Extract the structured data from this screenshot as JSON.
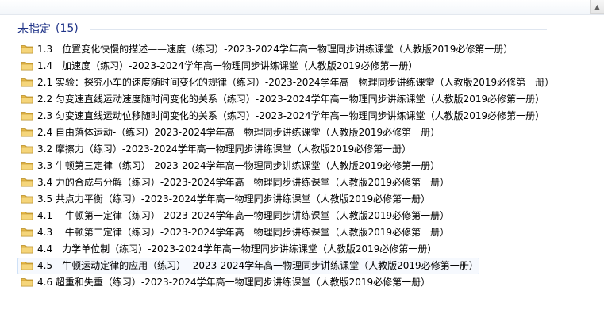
{
  "group": {
    "title": "未指定",
    "count": "(15)"
  },
  "folder_color": "#e8bb4a",
  "items": [
    {
      "label": "1.3　位置变化快慢的描述——速度（练习）-2023-2024学年高一物理同步讲练课堂（人教版2019必修第一册）"
    },
    {
      "label": "1.4　加速度（练习）-2023-2024学年高一物理同步讲练课堂（人教版2019必修第一册）"
    },
    {
      "label": "2.1  实验：探究小车的速度随时间变化的规律（练习）-2023-2024学年高一物理同步讲练课堂（人教版2019必修第一册）"
    },
    {
      "label": "2.2  匀变速直线运动速度随时间变化的关系（练习）-2023-2024学年高一物理同步讲练课堂（人教版2019必修第一册）"
    },
    {
      "label": "2.3  匀变速直线运动位移随时间变化的关系（练习）-2023-2024学年高一物理同步讲练课堂（人教版2019必修第一册）"
    },
    {
      "label": "2.4 自由落体运动-（练习）2023-2024学年高一物理同步讲练课堂（人教版2019必修第一册）"
    },
    {
      "label": "3.2  摩擦力（练习）-2023-2024学年高一物理同步讲练课堂（人教版2019必修第一册）"
    },
    {
      "label": "3.3  牛顿第三定律（练习）-2023-2024学年高一物理同步讲练课堂（人教版2019必修第一册）"
    },
    {
      "label": "3.4  力的合成与分解（练习）-2023-2024学年高一物理同步讲练课堂（人教版2019必修第一册）"
    },
    {
      "label": "3.5  共点力平衡（练习）-2023-2024学年高一物理同步讲练课堂（人教版2019必修第一册）"
    },
    {
      "label": "4.1　 牛顿第一定律（练习）-2023-2024学年高一物理同步讲练课堂（人教版2019必修第一册）"
    },
    {
      "label": "4.3　 牛顿第二定律（练习）-2023-2024学年高一物理同步讲练课堂（人教版2019必修第一册）"
    },
    {
      "label": "4.4　力学单位制（练习）-2023-2024学年高一物理同步讲练课堂（人教版2019必修第一册）"
    },
    {
      "label": "4.5　牛顿运动定律的应用（练习）--2023-2024学年高一物理同步讲练课堂（人教版2019必修第一册）"
    },
    {
      "label": "4.6  超重和失重（练习）-2023-2024学年高一物理同步讲练课堂（人教版2019必修第一册）"
    }
  ],
  "selected_index": 13
}
